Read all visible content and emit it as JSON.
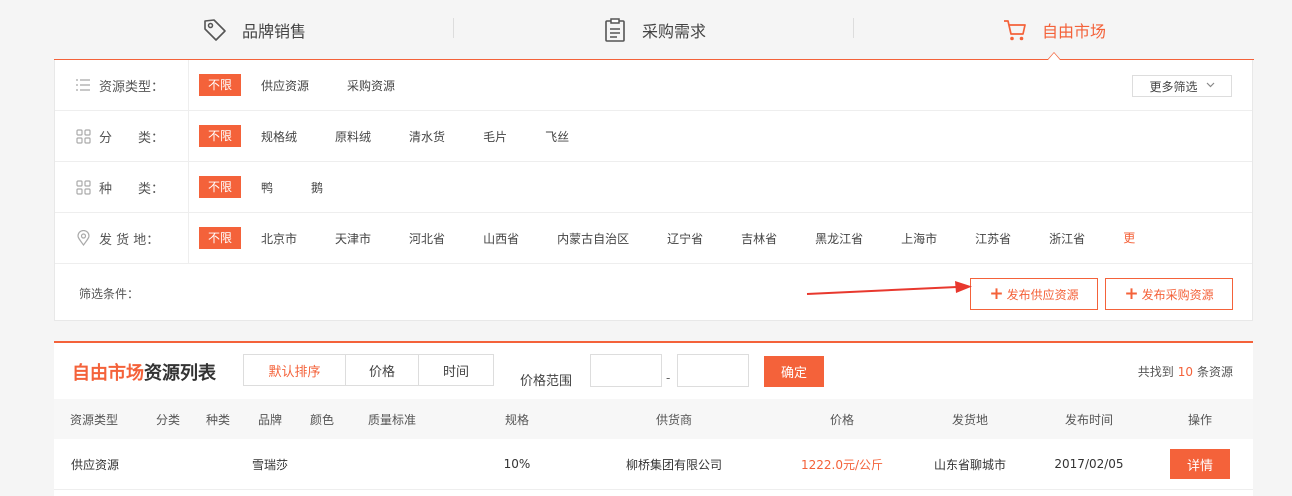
{
  "tabs": [
    {
      "label": "品牌销售",
      "icon": "tag-icon"
    },
    {
      "label": "采购需求",
      "icon": "clipboard-icon"
    },
    {
      "label": "自由市场",
      "icon": "cart-icon"
    }
  ],
  "filters": {
    "resource_type": {
      "label": "资源类型：",
      "items": [
        "不限",
        "供应资源",
        "采购资源"
      ]
    },
    "category": {
      "label": "分　　类：",
      "items": [
        "不限",
        "规格绒",
        "原料绒",
        "清水货",
        "毛片",
        "飞丝"
      ]
    },
    "species": {
      "label": "种　　类：",
      "items": [
        "不限",
        "鸭",
        "鹅"
      ]
    },
    "origin": {
      "label": "发 货 地：",
      "items": [
        "不限",
        "北京市",
        "天津市",
        "河北省",
        "山西省",
        "内蒙古自治区",
        "辽宁省",
        "吉林省",
        "黑龙江省",
        "上海市",
        "江苏省",
        "浙江省",
        "更多"
      ]
    },
    "more_filter": "更多筛选",
    "condition_label": "筛选条件：",
    "publish_supply": "发布供应资源",
    "publish_purchase": "发布采购资源"
  },
  "list": {
    "title_hl": "自由市场",
    "title_rest": "资源列表",
    "sorts": [
      "默认排序",
      "价格",
      "时间"
    ],
    "price_range_label": "价格范围",
    "price_min": "",
    "price_max": "",
    "dash": "-",
    "confirm": "确定",
    "count_prefix": "共找到",
    "count": "10",
    "count_suffix": "条资源",
    "columns": [
      "资源类型",
      "分类",
      "种类",
      "品牌",
      "颜色",
      "质量标准",
      "规格",
      "供货商",
      "价格",
      "发货地",
      "发布时间",
      "操作"
    ],
    "rows": [
      {
        "type": "供应资源",
        "category": "",
        "species": "",
        "brand": "雪瑞莎",
        "color": "",
        "quality": "",
        "spec": "10%",
        "supplier": "柳桥集团有限公司",
        "price": "1222.0元/公斤",
        "origin": "山东省聊城市",
        "date": "2017/02/05",
        "action": "详情"
      }
    ]
  },
  "colors": {
    "accent": "#f4623a"
  }
}
